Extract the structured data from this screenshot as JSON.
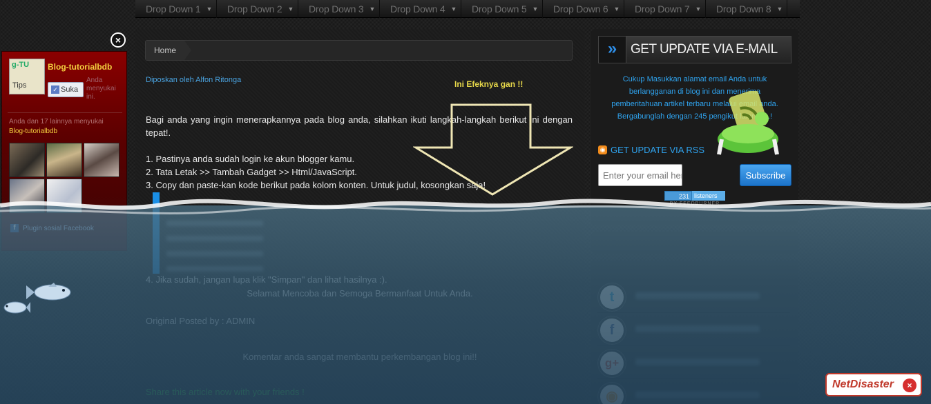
{
  "nav": {
    "items": [
      "Drop Down 1",
      "Drop Down 2",
      "Drop Down 3",
      "Drop Down 4",
      "Drop Down 5",
      "Drop Down 6",
      "Drop Down 7",
      "Drop Down 8"
    ]
  },
  "breadcrumb": {
    "home": "Home"
  },
  "post": {
    "posted_by": "Diposkan oleh Alfon Ritonga",
    "effect_note": "Ini Efeknya gan !!",
    "intro": "Bagi anda yang ingin menerapkannya pada blog anda, silahkan ikuti langkah-langkah berikut ini dengan tepat!.",
    "step1": "1. Pastinya anda sudah login ke akun blogger kamu.",
    "step2": "2. Tata Letak >> Tambah Gadget >> Html/JavaScript.",
    "step3": "3. Copy dan paste-kan kode berikut pada kolom konten. Untuk judul, kosongkan saja!",
    "step4": "4. Jika sudah, jangan lupa klik \"Simpan\" dan lihat hasilnya :).",
    "closing": "Selamat Mencoba dan Semoga Bermanfaat Untuk Anda.",
    "original": "Original Posted by : ADMIN",
    "comment_note": "Komentar anda sangat membantu perkembangan blog ini!!",
    "share": "Share this article now with your friends !"
  },
  "facebook_widget": {
    "close_icon": "×",
    "logo_top": "g-TU",
    "logo_bottom": "Tips",
    "page_name": "Blog-tutorialbdb",
    "like_label": "Suka",
    "like_note": "Anda menyukai ini.",
    "count_text": "Anda dan 17 lainnya menyukai",
    "page_link": "Blog-tutorialbdb",
    "plugin_label": "Plugin sosial Facebook"
  },
  "email_widget": {
    "title": "GET UPDATE VIA E-MAIL",
    "description": "Cukup Masukkan alamat email Anda untuk berlangganan di blog ini dan menerima pemberitahuan artikel terbaru melalui email anda. Bergabunglah dengan 245 pengikut lainnya...!",
    "rss_label": "GET UPDATE VIA RSS",
    "email_placeholder": "Enter your email here..",
    "subscribe_label": "Subscribe",
    "listeners_count": "231",
    "listeners_label": "listeners",
    "feedburner_label": "BY FEEDBURNER"
  },
  "social": {
    "icons": [
      "twitter-icon",
      "facebook-icon",
      "google-plus-icon",
      "rss-icon"
    ]
  },
  "netdisaster": {
    "label": "NetDisaster",
    "close": "×"
  },
  "colors": {
    "accent_blue": "#2fa3ee",
    "share_green": "#2fd12f",
    "title_yellow": "#e8d94a"
  }
}
